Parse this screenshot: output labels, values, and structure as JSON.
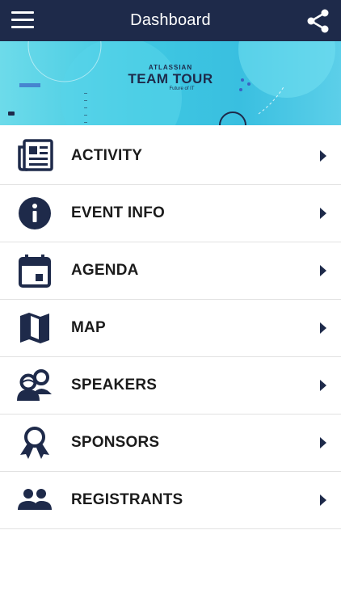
{
  "header": {
    "title": "Dashboard"
  },
  "banner": {
    "brand_top": "ATLASSIAN",
    "brand_main": "TEAM TOUR",
    "brand_sub": "Future of IT"
  },
  "menu": {
    "items": [
      {
        "label": "ACTIVITY",
        "icon": "newspaper-icon"
      },
      {
        "label": "EVENT INFO",
        "icon": "info-icon"
      },
      {
        "label": "AGENDA",
        "icon": "calendar-icon"
      },
      {
        "label": "MAP",
        "icon": "map-icon"
      },
      {
        "label": "SPEAKERS",
        "icon": "speakers-icon"
      },
      {
        "label": "SPONSORS",
        "icon": "ribbon-award-icon"
      },
      {
        "label": "REGISTRANTS",
        "icon": "people-icon"
      }
    ]
  },
  "colors": {
    "header_bg": "#1e2a4a",
    "icon_color": "#1e2a4a",
    "banner_accent": "#3fc8e2"
  }
}
